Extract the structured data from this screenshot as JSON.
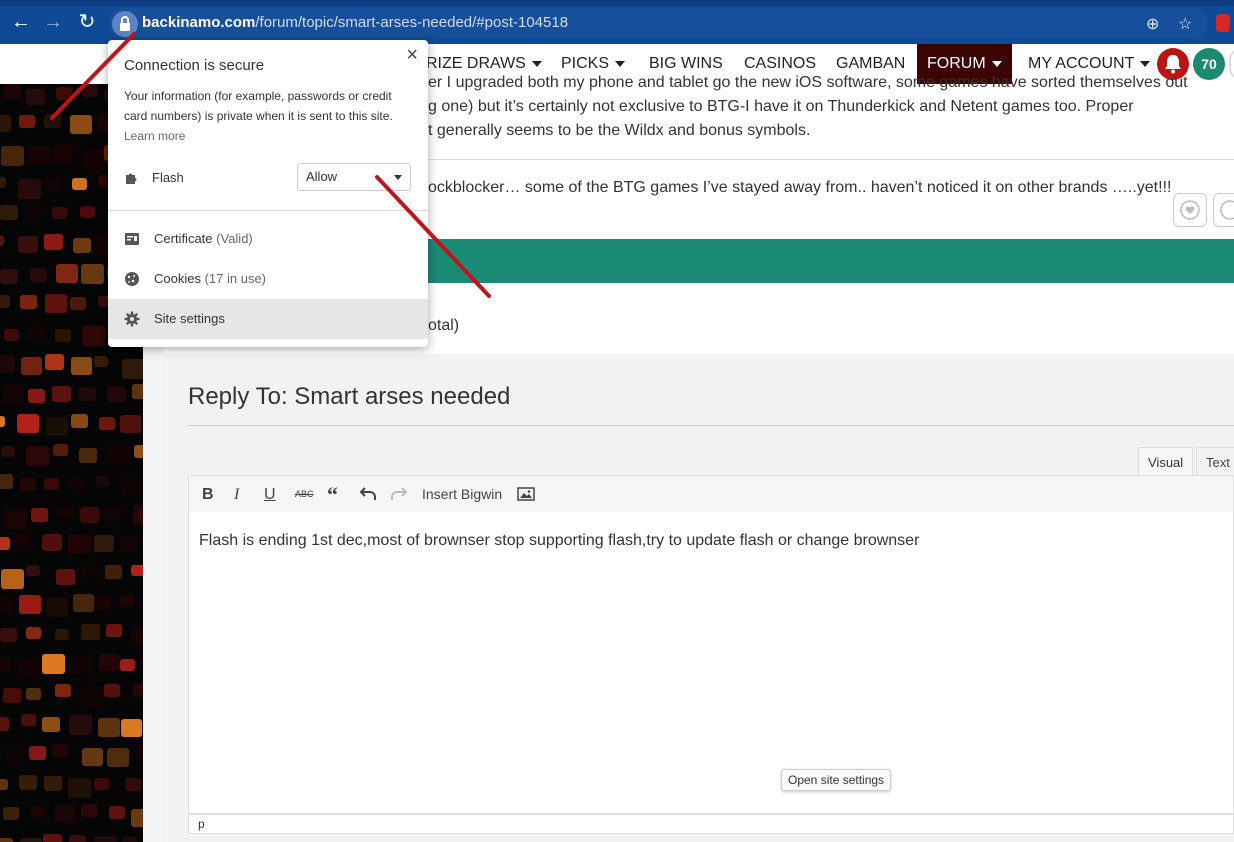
{
  "browser": {
    "url_domain": "backinamo.com",
    "url_path": "/forum/topic/smart-arses-needed/#post-104518"
  },
  "site_nav": {
    "items": [
      {
        "label": "RIZE DRAWS"
      },
      {
        "label": "PICKS"
      },
      {
        "label": "BIG WINS"
      },
      {
        "label": "CASINOS"
      },
      {
        "label": "GAMBAN"
      },
      {
        "label": "FORUM"
      },
      {
        "label": "MY ACCOUNT"
      }
    ],
    "badge_count": "70"
  },
  "post": {
    "line1": "er I upgraded both my phone and tablet go the new iOS software, some games have sorted themselves out",
    "line2": "g one) but it’s certainly not exclusive to BTG-I have it on Thunderkick and Netent games too. Proper",
    "line3": "t generally seems to be the Wildx and bonus symbols.",
    "line4": "ockblocker… some of the BTG games I’ve stayed away from.. haven’t noticed it on other brands …..yet!!!",
    "total_fragment": "otal)"
  },
  "reply": {
    "title": "Reply To: Smart arses needed",
    "tab_visual": "Visual",
    "tab_text": "Text",
    "insert_bigwin": "Insert Bigwin",
    "editor_text": "Flash is ending 1st dec,most of brownser stop supporting flash,try to update flash or change brownser",
    "path": "p",
    "tooltip": "Open site settings"
  },
  "popup": {
    "title": "Connection is secure",
    "info": "Your information (for example, passwords or credit card numbers) is private when it is sent to this site.",
    "learn_more": "Learn more",
    "flash_label": "Flash",
    "flash_value": "Allow",
    "certificate_label": "Certificate",
    "certificate_status": "(Valid)",
    "cookies_label": "Cookies",
    "cookies_status": "(17 in use)",
    "site_settings_label": "Site settings"
  },
  "colors": {
    "chrome_blue": "#0f4a96",
    "forum_bg": "#3d0404",
    "teal": "#1b8a74",
    "annotation_red": "#c0141a"
  }
}
